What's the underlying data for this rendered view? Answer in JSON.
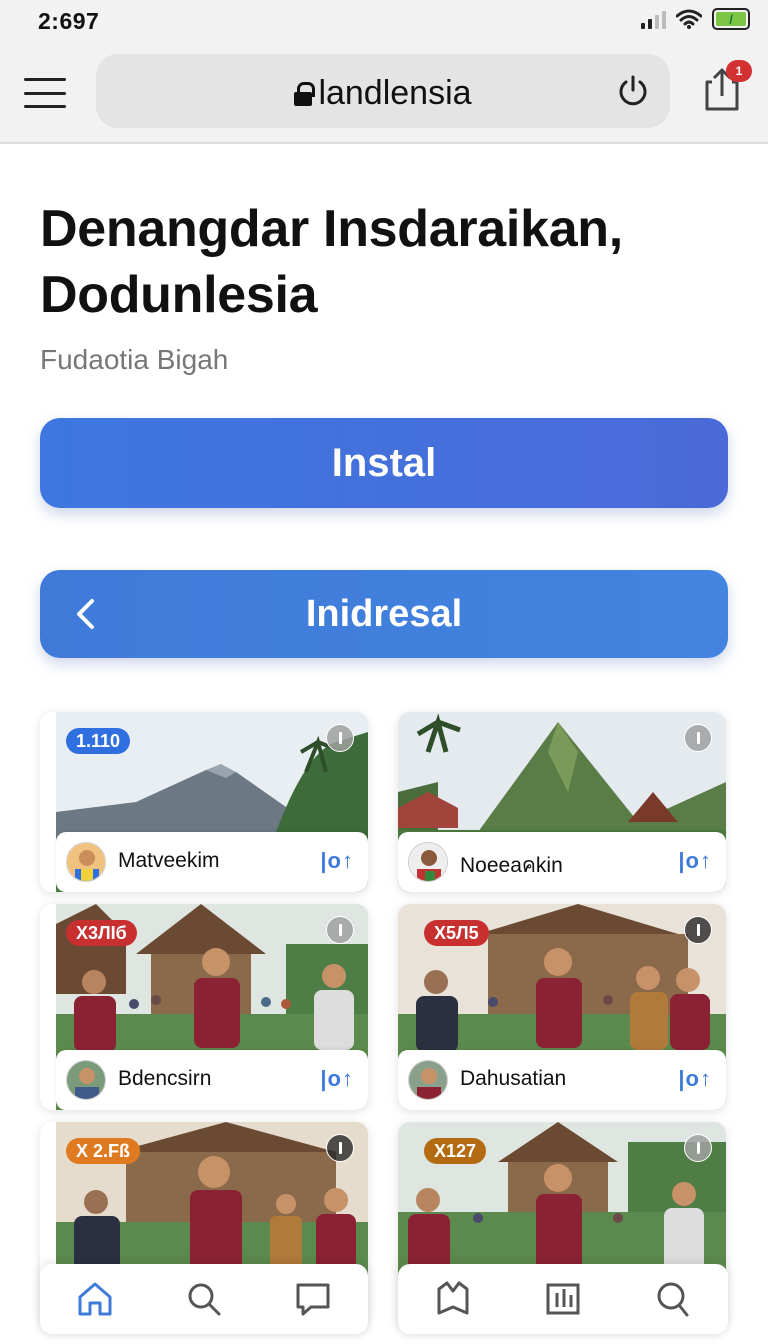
{
  "status_bar": {
    "time": "2:697",
    "battery_label": "/"
  },
  "browser": {
    "url": "landlensia",
    "share_badge": "1"
  },
  "page": {
    "title": "Denangdar Insdaraikan, Dodunlesia",
    "subtitle": "Fudaotia Bigah",
    "primary_button": "Instal",
    "secondary_button": "Inidresal"
  },
  "cards": [
    {
      "badge": "1.110",
      "badge_color": "#2f6fe0",
      "name": "Matveekim",
      "action": "|o↑"
    },
    {
      "badge": "",
      "badge_color": "",
      "name": "Noeeaคkin",
      "action": "|o↑"
    },
    {
      "badge": "X3ЛIб",
      "badge_color": "#c83030",
      "name": "Bdencsirn",
      "action": "|o↑"
    },
    {
      "badge": "X5Л5",
      "badge_color": "#c83030",
      "name": "Dahusatian",
      "action": "|o↑"
    },
    {
      "badge": "X 2.Fß",
      "badge_color": "#e07a20",
      "name": "",
      "action": ""
    },
    {
      "badge": "X127",
      "badge_color": "#b46a10",
      "name": "",
      "action": ""
    }
  ],
  "icons": {
    "menu": "hamburger-icon",
    "lock": "lock-icon",
    "reload": "power-reload-icon",
    "share": "share-icon",
    "tabs_left": [
      "home-icon",
      "search-icon",
      "chat-icon"
    ],
    "tabs_right": [
      "bookmark-icon",
      "library-icon",
      "search-icon"
    ]
  },
  "colors": {
    "accent": "#3f7ad9",
    "badge_red": "#d23232"
  }
}
